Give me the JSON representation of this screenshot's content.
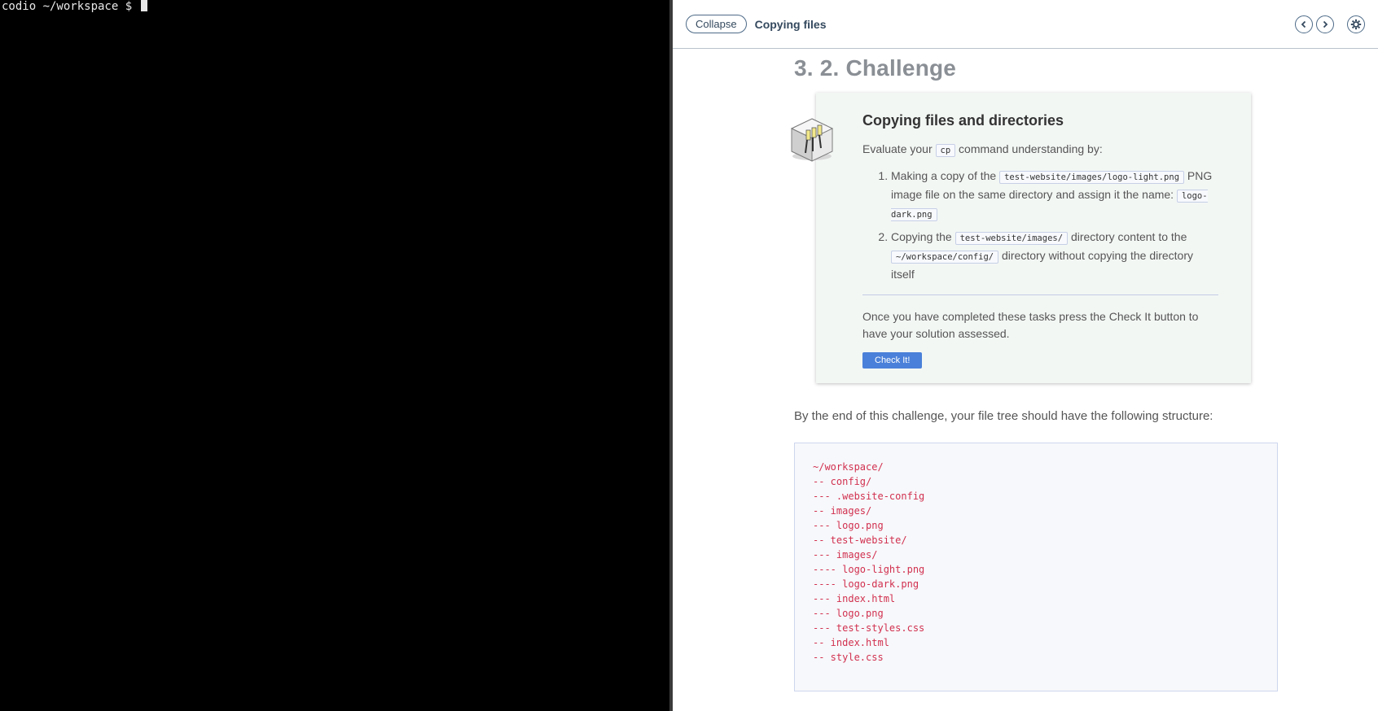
{
  "terminal": {
    "prompt": "codio ~/workspace $"
  },
  "header": {
    "collapse_label": "Collapse",
    "title": "Copying files",
    "icons": [
      "chevron-left-icon",
      "chevron-right-icon",
      "gear-icon"
    ]
  },
  "section": {
    "heading": "3. 2. Challenge"
  },
  "challenge": {
    "title": "Copying files and directories",
    "intro_before": "Evaluate your",
    "intro_code": "cp",
    "intro_after": "command understanding by:",
    "tasks": [
      {
        "pre": "Making a copy of the",
        "code1": "test-website/images/logo-light.png",
        "mid": "PNG image file on the same directory and assign it the name:",
        "code2": "logo-dark.png",
        "post": ""
      },
      {
        "pre": "Copying the",
        "code1": "test-website/images/",
        "mid": "directory content to the",
        "code2": "~/workspace/config/",
        "post": "directory without copying the directory itself"
      }
    ],
    "completion_text": "Once you have completed these tasks press the Check It button to have your solution assessed.",
    "check_button": "Check It!"
  },
  "structure_intro": "By the end of this challenge, your file tree should have the following structure:",
  "file_tree": [
    "~/workspace/",
    "-- config/",
    "--- .website-config",
    "-- images/",
    "--- logo.png",
    "-- test-website/",
    "--- images/",
    "---- logo-light.png",
    "---- logo-dark.png",
    "--- index.html",
    "--- logo.png",
    "--- test-styles.css",
    "-- index.html",
    "-- style.css"
  ],
  "colors": {
    "accent_button": "#4a80d9",
    "tree_text": "#d1304f",
    "terminal_bg": "#000000"
  }
}
